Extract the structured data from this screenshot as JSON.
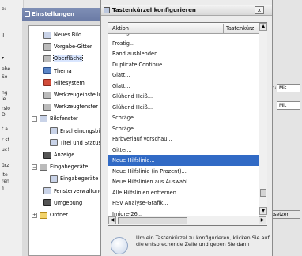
{
  "background_left": {
    "fragments": [
      "e:",
      "il",
      "▾",
      "ebe",
      "So",
      "ng",
      "ie",
      "rsio",
      "Di",
      "t a",
      "r st",
      "uc!",
      "ürz",
      "ite",
      "ren",
      "1"
    ]
  },
  "preferences": {
    "title": "Einstellungen",
    "tree": [
      {
        "label": "Neues Bild",
        "icon": "new-image-icon"
      },
      {
        "label": "Vorgabe-Gitter",
        "icon": "grid-icon"
      },
      {
        "label": "Oberfläche",
        "icon": "interface-icon",
        "selected": true
      },
      {
        "label": "Thema",
        "icon": "theme-icon"
      },
      {
        "label": "Hilfesystem",
        "icon": "help-icon"
      },
      {
        "label": "Werkzeugeinstellung",
        "icon": "tool-options-icon"
      },
      {
        "label": "Werkzeugfenster",
        "icon": "toolbox-icon"
      },
      {
        "label": "Bildfenster",
        "icon": "image-window-icon",
        "expander": "−"
      },
      {
        "label": "Erscheinungsbild",
        "icon": "appearance-icon"
      },
      {
        "label": "Titel und Status",
        "icon": "title-status-icon"
      },
      {
        "label": "Anzeige",
        "icon": "display-icon"
      },
      {
        "label": "Eingabegeräte",
        "icon": "input-devices-icon",
        "expander": "−"
      },
      {
        "label": "Eingabegeräte",
        "icon": "input-controllers-icon"
      },
      {
        "label": "Fensterverwaltung",
        "icon": "window-management-icon"
      },
      {
        "label": "Umgebung",
        "icon": "environment-icon"
      },
      {
        "label": "Ordner",
        "icon": "folder-icon",
        "expander": "+"
      }
    ]
  },
  "background_right": {
    "label_fragment": "en:",
    "field1": "Mit",
    "field2": "Mit",
    "button_fragment": "ksetzen"
  },
  "dialog": {
    "title": "Tastenkürzel konfigurieren",
    "close_label": "x",
    "columns": {
      "action": "Aktion",
      "shortcut": "Tastenkürz"
    },
    "rows": [
      "Frostig...",
      "Frostig...",
      "Rand ausblenden...",
      "Duplicate Continue",
      "Glatt...",
      "Glatt...",
      "Glühend Heiß...",
      "Glühend Heiß...",
      "Schräge...",
      "Schräge...",
      "Farbverlauf Vorschau...",
      "Gitter...",
      "Neue Hilfslinie...",
      "Neue Hilfslinie (in Prozent)...",
      "Neue Hilfslinien aus Auswahl",
      "Alle Hilfslinien entfernen",
      "HSV Analyse-Grafik...",
      "Imigre-26...",
      "Alle von GetCrafik"
    ],
    "selected_row_index": 12,
    "hint": "Um ein Tastenkürzel zu konfigurieren, klicken Sie auf die entsprechende Zeile und geben Sie dann"
  }
}
